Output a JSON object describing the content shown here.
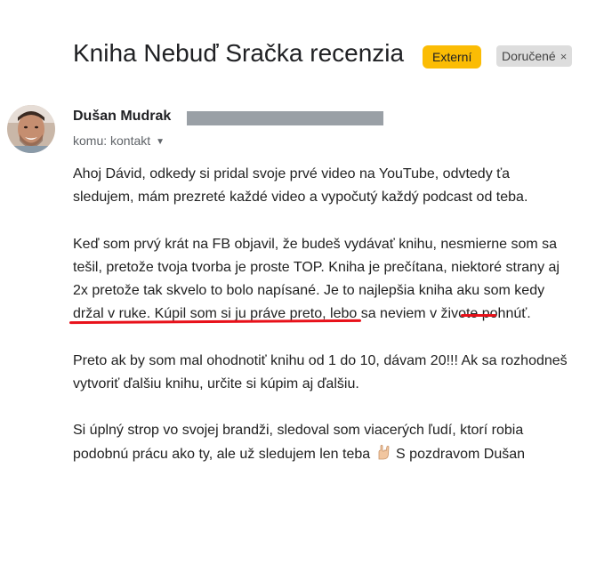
{
  "email": {
    "subject": "Kniha Nebuď Sračka recenzia",
    "labels": {
      "external": "Externí",
      "inbox": "Doručené",
      "inbox_remove": "×"
    },
    "sender": {
      "name": "Dušan Mudrak",
      "recipient": "komu: kontakt"
    },
    "body": {
      "p1": "Ahoj Dávid, odkedy si pridal svoje prvé video na YouTube, odvtedy ťa sledujem, mám prezreté každé video a vypočutý každý podcast od teba.",
      "p2_a": "Keď som prvý krát na FB objavil, že budeš vydávať knihu, nesmierne som sa tešil, pretože tvoja tvorba je proste TOP. Kniha je prečítana, niektoré strany aj 2x pretože tak skvelo to bolo napísané. ",
      "p2_highlight": "Je to najlepšia kniha aku som kedy držal v ruke.",
      "p2_b": " Kúpil som si ju práve preto, lebo sa neviem v živote pohnúť.",
      "p3": "Preto ak by som mal ohodnotiť knihu od 1 do 10, dávam 20!!! Ak sa rozhodneš vytvoriť ďalšiu knihu, určite si kúpim aj ďalšiu.",
      "p4_a": "Si úplný strop vo svojej brandži, sledoval som viacerých ľudí, ktorí robia podobnú prácu ako ty, ale už sledujem len teba",
      "p4_b": " S pozdravom Dušan"
    }
  },
  "colors": {
    "external_badge": "#fbbc04",
    "underline": "#e8111a",
    "redaction": "#9aa0a6"
  },
  "icons": {
    "caret": "chevron-down-icon",
    "emoji": "rock-hand-emoji-icon"
  }
}
